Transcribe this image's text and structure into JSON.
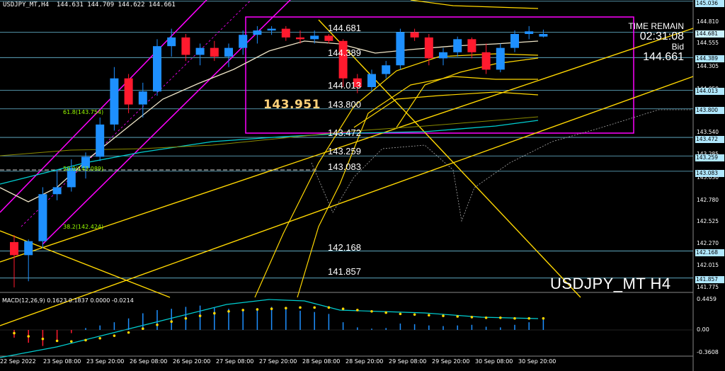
{
  "header": {
    "title": "USDJPY_MT,H4  144.631 144.709 144.622 144.661"
  },
  "watermark_symbol": "USDJPY_MT H4",
  "time_remain": {
    "label": "TIME REMAIN",
    "value": "02:31:08",
    "bid_label": "Bid",
    "bid_value": "144.661"
  },
  "highlight_price": "143.951",
  "level_labels": [
    "144.681",
    "144.389",
    "144.013",
    "143.800",
    "143.472",
    "143.259",
    "143.083",
    "142.168",
    "141.857"
  ],
  "fib_labels": [
    "61.8(143.754)",
    "50.0(143.089)",
    "38.2(142.424)"
  ],
  "price_axis": {
    "ticks": [
      "145.036",
      "144.810",
      "144.555",
      "144.305",
      "144.050",
      "143.795",
      "143.540",
      "143.285",
      "143.030",
      "142.780",
      "142.525",
      "142.270",
      "142.015",
      "141.775"
    ],
    "tags": [
      {
        "text": "145.036",
        "color": "#b0e8ff"
      },
      {
        "text": "144.681",
        "color": "#c9f2ff"
      },
      {
        "text": "144.389",
        "color": "#b0e8ff"
      },
      {
        "text": "144.013",
        "color": "#b0e8ff"
      },
      {
        "text": "143.800",
        "color": "#b0e8ff"
      },
      {
        "text": "143.472",
        "color": "#b0e8ff"
      },
      {
        "text": "143.259",
        "color": "#b0e8ff"
      },
      {
        "text": "143.083",
        "color": "#b0e8ff"
      },
      {
        "text": "142.168",
        "color": "#b0e8ff"
      },
      {
        "text": "141.857",
        "color": "#b0e8ff"
      }
    ]
  },
  "time_axis": [
    "22 Sep 2022",
    "23 Sep 08:00",
    "23 Sep 20:00",
    "26 Sep 08:00",
    "26 Sep 20:00",
    "27 Sep 08:00",
    "27 Sep 20:00",
    "28 Sep 08:00",
    "28 Sep 20:00",
    "29 Sep 08:00",
    "29 Sep 20:00",
    "30 Sep 08:00",
    "30 Sep 20:00"
  ],
  "macd": {
    "label": "MACD(12,26,9) 0.1623 0.1837 0.0000 -0.0214",
    "ticks": [
      "0.4459",
      "0.00",
      "-0.3608"
    ]
  },
  "colors": {
    "bull": "#1e90ff",
    "bear": "#ff1a2e",
    "magenta": "#ff00ff",
    "yellow": "#ffd700",
    "cyan": "#00ced1",
    "white_ma": "#f0e6c8",
    "level": "#7fdfff"
  },
  "chart_data": {
    "type": "candlestick",
    "symbol": "USDJPY_MT",
    "timeframe": "H4",
    "ylim": [
      141.7,
      145.05
    ],
    "candles": [
      {
        "o": 142.27,
        "h": 142.35,
        "l": 141.75,
        "c": 142.12
      },
      {
        "o": 142.12,
        "h": 142.3,
        "l": 141.82,
        "c": 142.28
      },
      {
        "o": 142.28,
        "h": 142.9,
        "l": 142.2,
        "c": 142.82
      },
      {
        "o": 142.82,
        "h": 143.1,
        "l": 142.75,
        "c": 142.9
      },
      {
        "o": 142.9,
        "h": 143.22,
        "l": 142.85,
        "c": 143.12
      },
      {
        "o": 143.12,
        "h": 143.3,
        "l": 143.0,
        "c": 143.25
      },
      {
        "o": 143.25,
        "h": 143.7,
        "l": 143.2,
        "c": 143.62
      },
      {
        "o": 143.62,
        "h": 144.28,
        "l": 143.55,
        "c": 144.15
      },
      {
        "o": 144.15,
        "h": 144.2,
        "l": 143.75,
        "c": 143.85
      },
      {
        "o": 143.85,
        "h": 144.1,
        "l": 143.7,
        "c": 144.0
      },
      {
        "o": 144.0,
        "h": 144.6,
        "l": 143.95,
        "c": 144.52
      },
      {
        "o": 144.52,
        "h": 144.72,
        "l": 144.4,
        "c": 144.62
      },
      {
        "o": 144.62,
        "h": 144.66,
        "l": 144.35,
        "c": 144.42
      },
      {
        "o": 144.42,
        "h": 144.55,
        "l": 144.3,
        "c": 144.5
      },
      {
        "o": 144.5,
        "h": 144.58,
        "l": 144.35,
        "c": 144.4
      },
      {
        "o": 144.4,
        "h": 144.55,
        "l": 144.28,
        "c": 144.5
      },
      {
        "o": 144.5,
        "h": 144.7,
        "l": 144.42,
        "c": 144.65
      },
      {
        "o": 144.65,
        "h": 144.75,
        "l": 144.55,
        "c": 144.7
      },
      {
        "o": 144.7,
        "h": 144.75,
        "l": 144.65,
        "c": 144.72
      },
      {
        "o": 144.72,
        "h": 144.75,
        "l": 144.58,
        "c": 144.62
      },
      {
        "o": 144.62,
        "h": 144.7,
        "l": 144.55,
        "c": 144.6
      },
      {
        "o": 144.6,
        "h": 144.7,
        "l": 144.55,
        "c": 144.64
      },
      {
        "o": 144.64,
        "h": 144.66,
        "l": 144.55,
        "c": 144.58
      },
      {
        "o": 144.58,
        "h": 144.6,
        "l": 144.05,
        "c": 144.15
      },
      {
        "o": 144.15,
        "h": 144.2,
        "l": 143.98,
        "c": 144.05
      },
      {
        "o": 144.05,
        "h": 144.25,
        "l": 144.0,
        "c": 144.2
      },
      {
        "o": 144.2,
        "h": 144.35,
        "l": 144.15,
        "c": 144.3
      },
      {
        "o": 144.3,
        "h": 144.72,
        "l": 144.25,
        "c": 144.68
      },
      {
        "o": 144.68,
        "h": 144.72,
        "l": 144.58,
        "c": 144.62
      },
      {
        "o": 144.62,
        "h": 144.66,
        "l": 144.3,
        "c": 144.38
      },
      {
        "o": 144.38,
        "h": 144.5,
        "l": 144.3,
        "c": 144.45
      },
      {
        "o": 144.45,
        "h": 144.63,
        "l": 144.4,
        "c": 144.6
      },
      {
        "o": 144.6,
        "h": 144.62,
        "l": 144.38,
        "c": 144.45
      },
      {
        "o": 144.45,
        "h": 144.55,
        "l": 144.2,
        "c": 144.25
      },
      {
        "o": 144.25,
        "h": 144.55,
        "l": 144.22,
        "c": 144.5
      },
      {
        "o": 144.5,
        "h": 144.7,
        "l": 144.45,
        "c": 144.66
      },
      {
        "o": 144.66,
        "h": 144.75,
        "l": 144.6,
        "c": 144.69
      },
      {
        "o": 144.63,
        "h": 144.71,
        "l": 144.62,
        "c": 144.66
      }
    ],
    "macd_hist": [
      -0.12,
      -0.2,
      -0.25,
      -0.18,
      -0.05,
      0.03,
      0.07,
      0.12,
      0.18,
      0.26,
      0.31,
      0.33,
      0.36,
      0.38,
      0.35,
      0.33,
      0.3,
      0.34,
      0.36,
      0.33,
      0.3,
      0.28,
      0.25,
      0.12,
      0.04,
      0.02,
      0.03,
      0.1,
      0.09,
      0.07,
      0.06,
      0.07,
      0.08,
      0.05,
      0.04,
      0.08,
      0.12,
      0.16
    ],
    "macd_signal": [
      -0.05,
      -0.1,
      -0.14,
      -0.17,
      -0.18,
      -0.16,
      -0.13,
      -0.09,
      -0.04,
      0.02,
      0.08,
      0.13,
      0.18,
      0.22,
      0.26,
      0.29,
      0.31,
      0.32,
      0.33,
      0.34,
      0.35,
      0.35,
      0.35,
      0.33,
      0.31,
      0.29,
      0.27,
      0.25,
      0.24,
      0.23,
      0.22,
      0.21,
      0.2,
      0.19,
      0.19,
      0.18,
      0.18,
      0.18
    ]
  }
}
